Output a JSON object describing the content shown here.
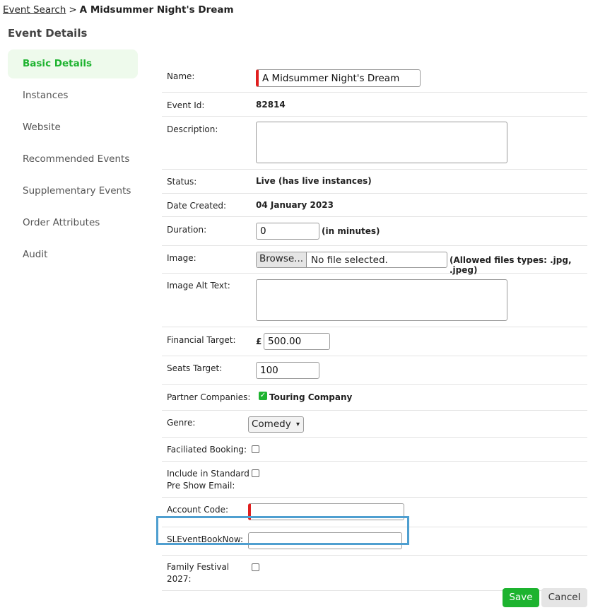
{
  "breadcrumb": {
    "parent": "Event Search",
    "separator": ">",
    "current": "A Midsummer Night's Dream"
  },
  "page_title": "Event Details",
  "sidebar": {
    "items": [
      {
        "label": "Basic Details",
        "active": true
      },
      {
        "label": "Instances"
      },
      {
        "label": "Website"
      },
      {
        "label": "Recommended Events"
      },
      {
        "label": "Supplementary Events"
      },
      {
        "label": "Order Attributes"
      },
      {
        "label": "Audit"
      }
    ]
  },
  "form": {
    "name": {
      "label": "Name:",
      "value": "A Midsummer Night's Dream"
    },
    "event_id": {
      "label": "Event Id:",
      "value": "82814"
    },
    "description": {
      "label": "Description:",
      "value": ""
    },
    "status": {
      "label": "Status:",
      "value": "Live (has live instances)"
    },
    "date_created": {
      "label": "Date Created:",
      "value": "04 January 2023"
    },
    "duration": {
      "label": "Duration:",
      "value": "0",
      "unit": "(in minutes)"
    },
    "image": {
      "label": "Image:",
      "browse": "Browse...",
      "file": "No file selected.",
      "hint": "(Allowed files types: .jpg, .jpeg)"
    },
    "image_alt": {
      "label": "Image Alt Text:",
      "value": ""
    },
    "financial_target": {
      "label": "Financial Target:",
      "currency": "£",
      "value": "500.00"
    },
    "seats_target": {
      "label": "Seats Target:",
      "value": "100"
    },
    "partner_companies": {
      "label": "Partner Companies:",
      "option": "Touring Company",
      "checked": true
    },
    "genre": {
      "label": "Genre:",
      "value": "Comedy"
    },
    "facilitated_booking": {
      "label": "Faciliated Booking:",
      "checked": false
    },
    "standard_email": {
      "label_line1": "Include in Standard",
      "label_line2": "Pre Show Email:",
      "checked": false
    },
    "account_code": {
      "label": "Account Code:",
      "value": ""
    },
    "sl_event_book_now": {
      "label": "SLEventBookNow:",
      "value": ""
    },
    "family_festival": {
      "label_line1": "Family Festival",
      "label_line2": "2027:",
      "checked": false
    }
  },
  "actions": {
    "save": "Save",
    "cancel": "Cancel"
  },
  "colors": {
    "accent": "#1db32f",
    "required": "#e01e1e",
    "highlight": "#4f9fd0"
  }
}
